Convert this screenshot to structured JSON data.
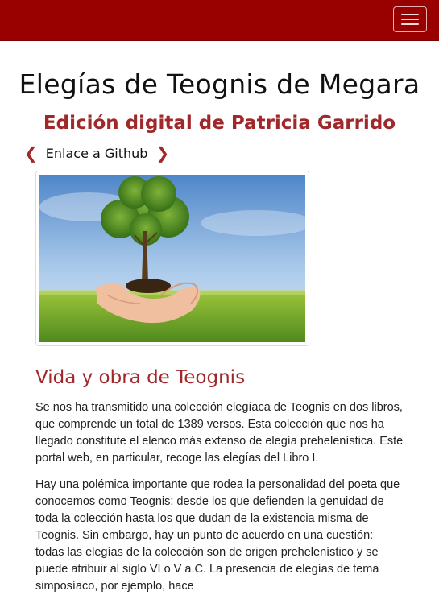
{
  "nav": {
    "toggle_icon": "hamburger-menu-icon",
    "brand_color": "#990000"
  },
  "header": {
    "title": "Elegías de Teognis de Megara",
    "subtitle": "Edición digital de Patricia Garrido",
    "github_link": "Enlace a Github"
  },
  "image": {
    "description_icon": "tree-in-hands-image"
  },
  "section": {
    "title": "Vida y obra de Teognis",
    "paragraphs": [
      "Se nos ha transmitido una colección elegíaca de Teognis en dos libros, que comprende un total de 1389 versos. Esta colección que nos ha llegado constitute el elenco más extenso de elegía prehelenística. Este portal web, en particular, recoge las elegías del Libro I.",
      "Hay una polémica importante que rodea la personalidad del poeta que conocemos como Teognis: desde los que defienden la genuidad de toda la colección hasta los que dudan de la existencia misma de Teognis. Sin embargo, hay un punto de acuerdo en una cuestión: todas las elegías de la colección son de origen prehelenístico y se puede atribuir al siglo VI o V a.C. La presencia de elegías de tema simposíaco, por ejemplo, hace"
    ]
  },
  "colors": {
    "accent": "#a0282b"
  }
}
